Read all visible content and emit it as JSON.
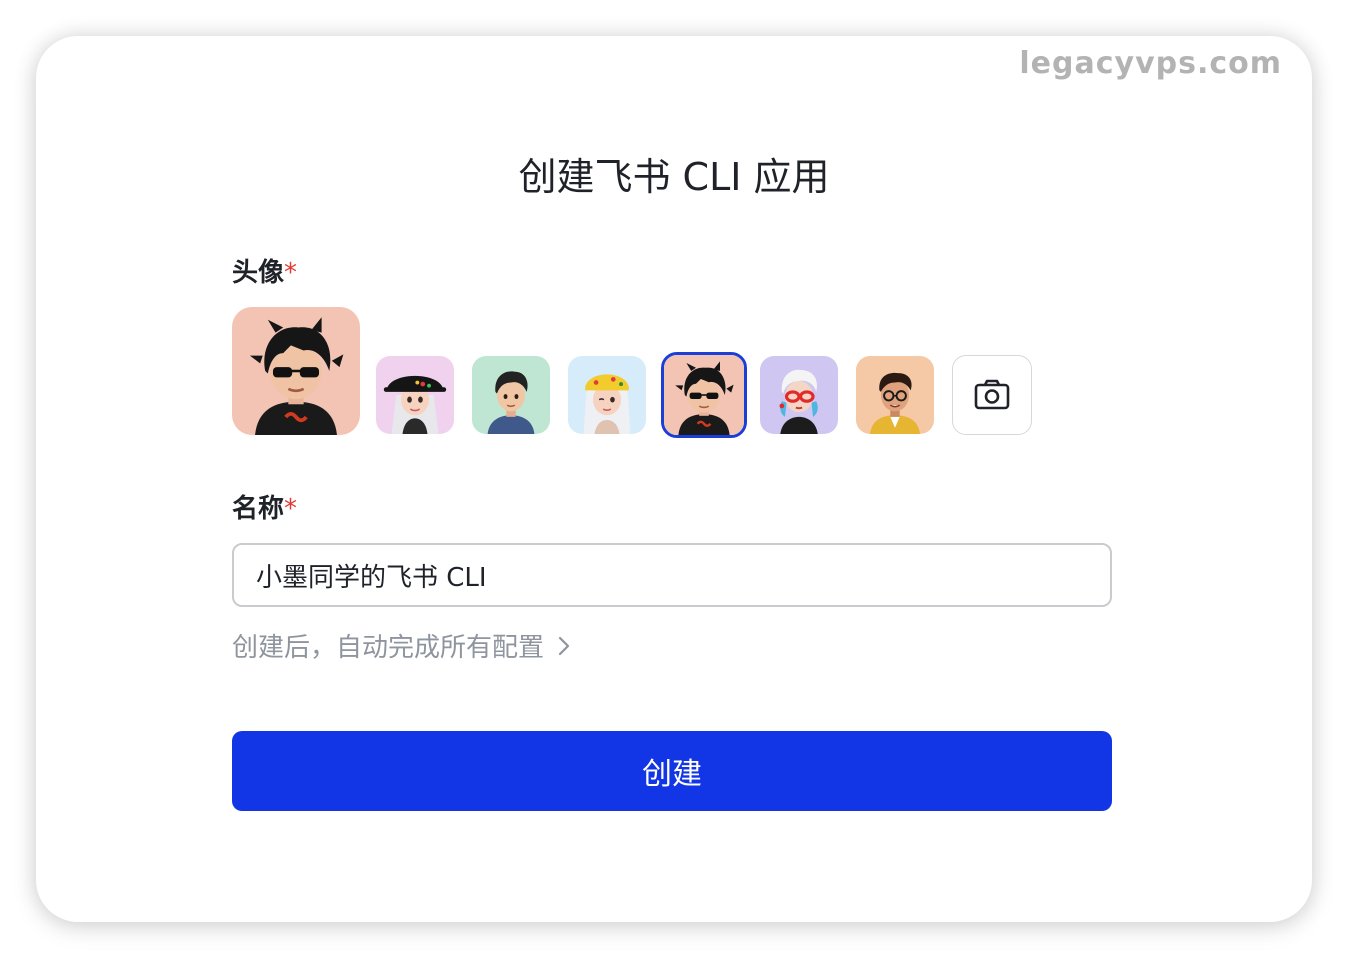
{
  "watermark": "legacyvps.com",
  "dialog": {
    "title": "创建飞书 CLI 应用",
    "avatar_label": "头像",
    "name_label": "名称",
    "required_mark": "*",
    "name_value": "小墨同学的飞书 CLI",
    "hint_text": "创建后，自动完成所有配置",
    "create_button_label": "创建"
  },
  "avatars": [
    {
      "icon": "avatar-sunglasses-boy",
      "bg": "#f3c3b4"
    },
    {
      "icon": "avatar-bucket-hat-girl",
      "bg": "#f0d2ee"
    },
    {
      "icon": "avatar-boy",
      "bg": "#bfe6d3"
    },
    {
      "icon": "avatar-headband-girl",
      "bg": "#d6ecfb"
    },
    {
      "icon": "avatar-sunglasses-boy",
      "bg": "#f3c3b4",
      "selected": true
    },
    {
      "icon": "avatar-red-glasses-girl",
      "bg": "#cfc7f1"
    },
    {
      "icon": "avatar-glasses-boy",
      "bg": "#f5c8a6"
    }
  ],
  "colors": {
    "primary": "#1236e6",
    "selected_border": "#1b3fd6",
    "required": "#e53935",
    "hint": "#8f959e"
  }
}
